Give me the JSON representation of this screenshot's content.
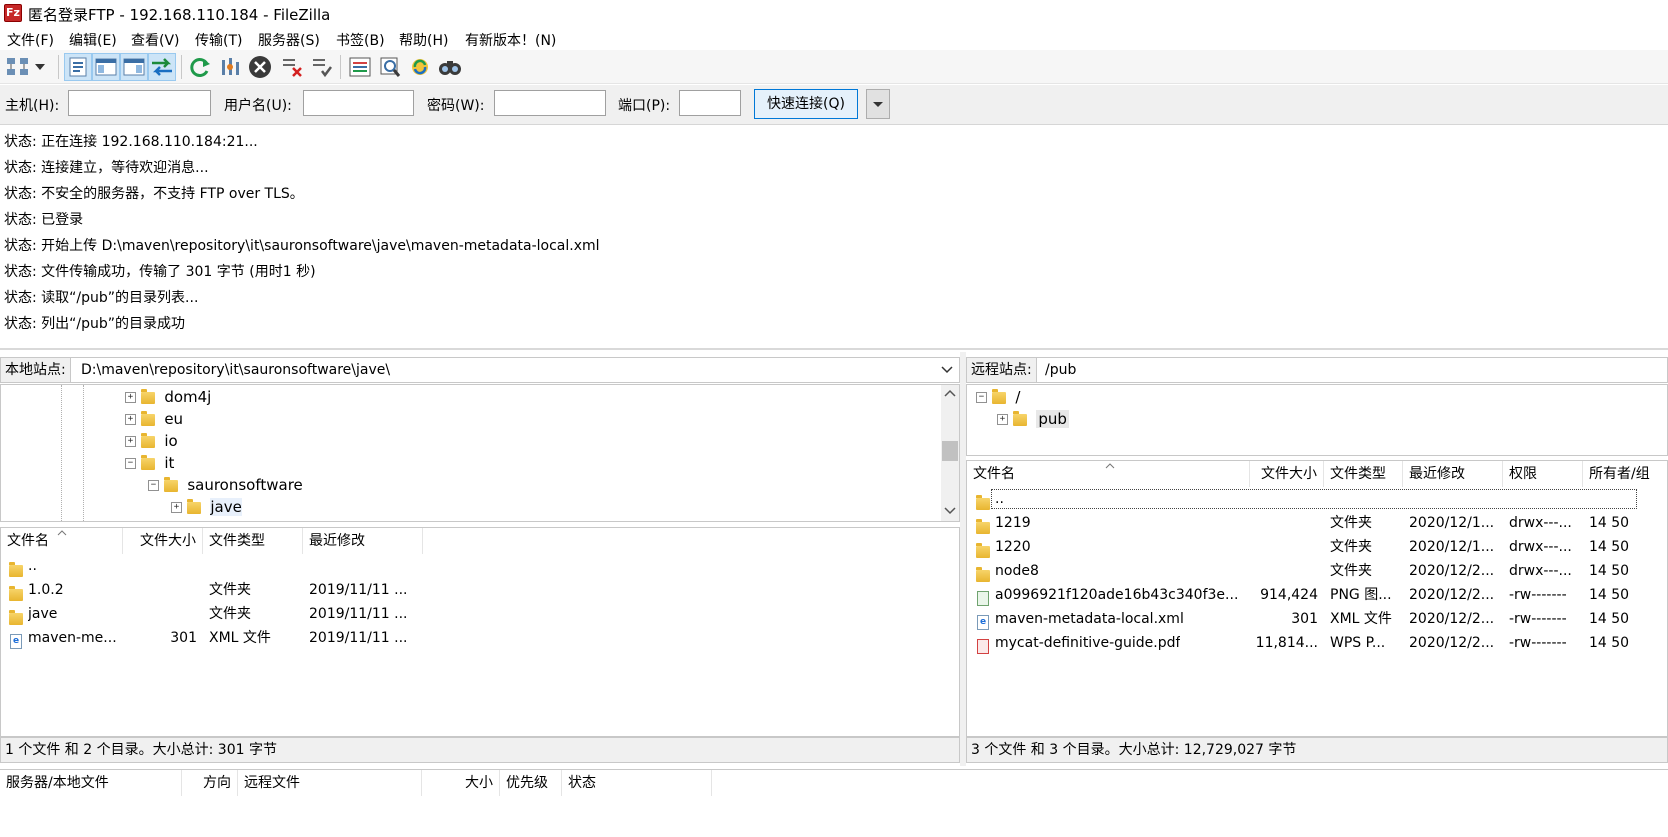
{
  "window": {
    "title": "匿名登录FTP - 192.168.110.184 - FileZilla",
    "app_icon": "Fz"
  },
  "menu": [
    "文件(F)",
    "编辑(E)",
    "查看(V)",
    "传输(T)",
    "服务器(S)",
    "书签(B)",
    "帮助(H)",
    "有新版本！(N)"
  ],
  "toolbar": {
    "icons": [
      "site-manager-icon",
      "dropdown-arrow-icon",
      "toggle-message-log-icon",
      "toggle-local-tree-icon",
      "toggle-remote-tree-icon",
      "toggle-transfer-queue-icon",
      "refresh-icon",
      "process-queue-icon",
      "cancel-operation-icon",
      "disconnect-icon",
      "reconnect-icon",
      "directory-filters-icon",
      "toggle-sync-browsing-icon",
      "directory-comparison-icon",
      "search-files-icon"
    ]
  },
  "quickconnect": {
    "host_label": "主机(H):",
    "host_value": "",
    "user_label": "用户名(U):",
    "user_value": "",
    "pass_label": "密码(W):",
    "pass_value": "",
    "port_label": "端口(P):",
    "port_value": "",
    "connect_label": "快速连接(Q)"
  },
  "log": [
    {
      "prefix": "状态:",
      "text": "正在连接 192.168.110.184:21..."
    },
    {
      "prefix": "状态:",
      "text": "连接建立，等待欢迎消息..."
    },
    {
      "prefix": "状态:",
      "text": "不安全的服务器，不支持 FTP over TLS。"
    },
    {
      "prefix": "状态:",
      "text": "已登录"
    },
    {
      "prefix": "状态:",
      "text": "开始上传 D:\\maven\\repository\\it\\sauronsoftware\\jave\\maven-metadata-local.xml"
    },
    {
      "prefix": "状态:",
      "text": "文件传输成功，传输了 301 字节 (用时1 秒)"
    },
    {
      "prefix": "状态:",
      "text": "读取“/pub”的目录列表..."
    },
    {
      "prefix": "状态:",
      "text": "列出“/pub”的目录成功"
    }
  ],
  "local": {
    "site_label": "本地站点:",
    "path": "D:\\maven\\repository\\it\\sauronsoftware\\jave\\",
    "tree": [
      {
        "name": "dom4j",
        "expander": "+"
      },
      {
        "name": "eu",
        "expander": "+"
      },
      {
        "name": "io",
        "expander": "+"
      },
      {
        "name": "it",
        "expander": "−"
      },
      {
        "name": "sauronsoftware",
        "expander": "−"
      },
      {
        "name": "jave",
        "expander": "+"
      }
    ],
    "columns": [
      "文件名",
      "文件大小",
      "文件类型",
      "最近修改"
    ],
    "files": [
      {
        "name": "..",
        "size": "",
        "type": "",
        "modified": "",
        "icon": "folder"
      },
      {
        "name": "1.0.2",
        "size": "",
        "type": "文件夹",
        "modified": "2019/11/11 ...",
        "icon": "folder"
      },
      {
        "name": "jave",
        "size": "",
        "type": "文件夹",
        "modified": "2019/11/11 ...",
        "icon": "folder"
      },
      {
        "name": "maven-me...",
        "size": "301",
        "type": "XML 文件",
        "modified": "2019/11/11 ...",
        "icon": "xml"
      }
    ],
    "status": "1 个文件 和 2 个目录。大小总计: 301 字节"
  },
  "remote": {
    "site_label": "远程站点:",
    "path": "/pub",
    "tree": [
      {
        "name": "/",
        "expander": "−"
      },
      {
        "name": "pub",
        "expander": "+"
      }
    ],
    "columns": [
      "文件名",
      "文件大小",
      "文件类型",
      "最近修改",
      "权限",
      "所有者/组"
    ],
    "files": [
      {
        "name": "..",
        "size": "",
        "type": "",
        "modified": "",
        "perm": "",
        "owner": "",
        "icon": "folder"
      },
      {
        "name": "1219",
        "size": "",
        "type": "文件夹",
        "modified": "2020/12/1...",
        "perm": "drwx---...",
        "owner": "14 50",
        "icon": "folder"
      },
      {
        "name": "1220",
        "size": "",
        "type": "文件夹",
        "modified": "2020/12/1...",
        "perm": "drwx---...",
        "owner": "14 50",
        "icon": "folder"
      },
      {
        "name": "node8",
        "size": "",
        "type": "文件夹",
        "modified": "2020/12/2...",
        "perm": "drwx---...",
        "owner": "14 50",
        "icon": "folder"
      },
      {
        "name": "a0996921f120ade16b43c340f3e...",
        "size": "914,424",
        "type": "PNG 图...",
        "modified": "2020/12/2...",
        "perm": "-rw-------",
        "owner": "14 50",
        "icon": "png"
      },
      {
        "name": "maven-metadata-local.xml",
        "size": "301",
        "type": "XML 文件",
        "modified": "2020/12/2...",
        "perm": "-rw-------",
        "owner": "14 50",
        "icon": "xml"
      },
      {
        "name": "mycat-definitive-guide.pdf",
        "size": "11,814...",
        "type": "WPS P...",
        "modified": "2020/12/2...",
        "perm": "-rw-------",
        "owner": "14 50",
        "icon": "pdf"
      }
    ],
    "status": "3 个文件 和 3 个目录。大小总计: 12,729,027 字节"
  },
  "queue": {
    "columns": [
      "服务器/本地文件",
      "方向",
      "远程文件",
      "大小",
      "优先级",
      "状态"
    ]
  }
}
